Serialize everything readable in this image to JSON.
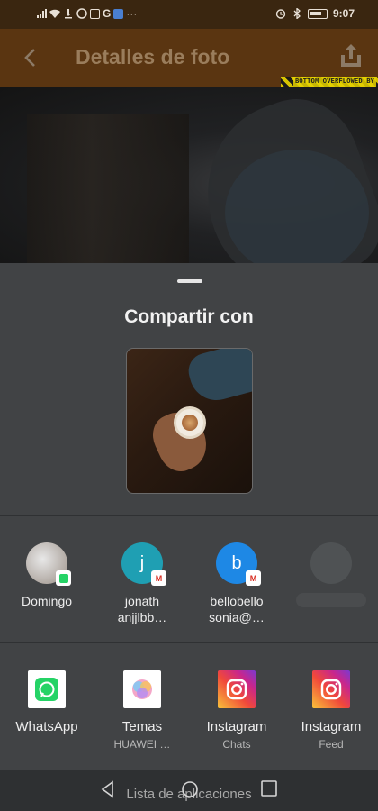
{
  "status_bar": {
    "time": "9:07"
  },
  "app_bar": {
    "title": "Detalles de foto",
    "debug_banner": "BOTTOM OVERFLOWED BY"
  },
  "share_sheet": {
    "title": "Compartir con",
    "contacts": [
      {
        "name": "Domingo",
        "name2": "",
        "avatar_letter": "",
        "avatar_color": "#d9d9d9",
        "badge": "whatsapp"
      },
      {
        "name": "jonath",
        "name2": "anjjlbb…",
        "avatar_letter": "j",
        "avatar_color": "#1f9fb3",
        "badge": "gmail"
      },
      {
        "name": "bellobello",
        "name2": "sonia@…",
        "avatar_letter": "b",
        "avatar_color": "#1e88e5",
        "badge": "gmail"
      }
    ],
    "apps": [
      {
        "label": "WhatsApp",
        "sub": "",
        "icon": "whatsapp-icon"
      },
      {
        "label": "Temas",
        "sub": "HUAWEI …",
        "icon": "themes-icon"
      },
      {
        "label": "Instagram",
        "sub": "Chats",
        "icon": "instagram-icon"
      },
      {
        "label": "Instagram",
        "sub": "Feed",
        "icon": "instagram-icon"
      }
    ]
  },
  "nav_bar": {
    "hint": "Lista de aplicaciones"
  },
  "colors": {
    "app_bar": "#5a3511",
    "sheet": "#414345",
    "accent_whatsapp": "#25d366"
  }
}
